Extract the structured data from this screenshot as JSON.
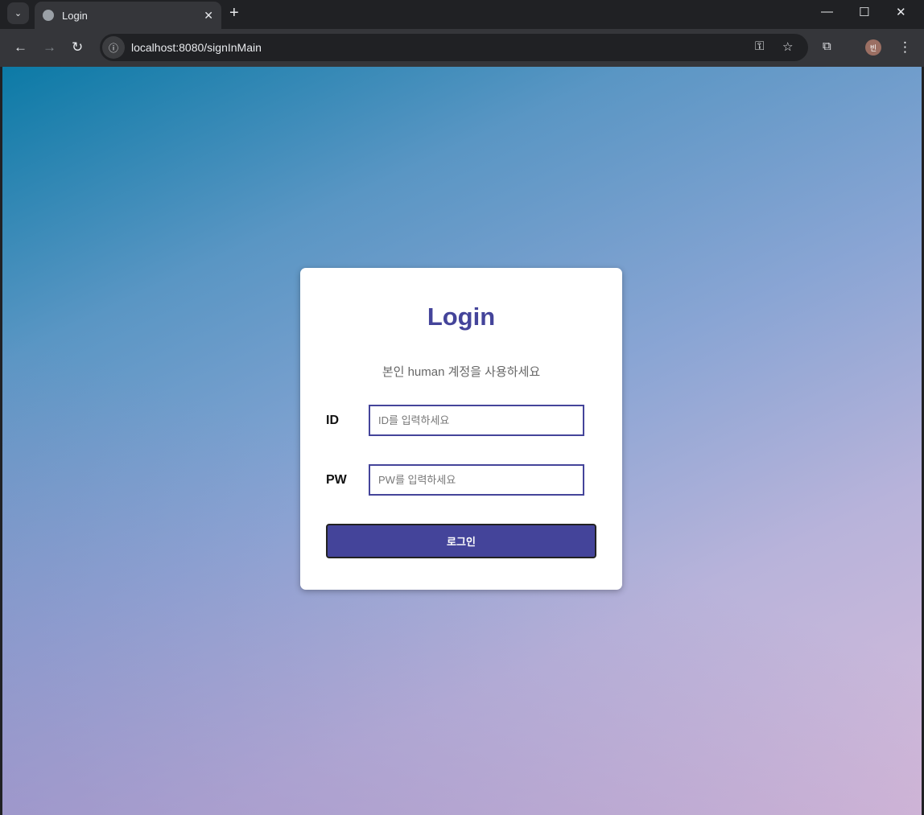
{
  "browser": {
    "tab_title": "Login",
    "url": "localhost:8080/signInMain",
    "profile_initial": "빈"
  },
  "login": {
    "title": "Login",
    "subtitle": "본인 human 계정을 사용하세요",
    "id_label": "ID",
    "id_placeholder": "ID를 입력하세요",
    "pw_label": "PW",
    "pw_placeholder": "PW를 입력하세요",
    "submit_label": "로그인"
  },
  "colors": {
    "accent": "#44449a",
    "gradient_start": "#0c7aa6",
    "gradient_end": "#d8bcda"
  }
}
